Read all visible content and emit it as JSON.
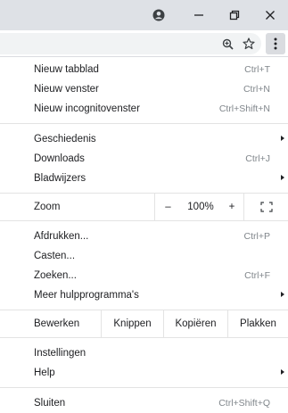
{
  "window": {
    "title_icons": [
      "account-icon",
      "minimize-icon",
      "restore-icon",
      "close-icon"
    ]
  },
  "toolbar": {
    "icons": [
      "zoom-in-icon",
      "bookmark-star-icon",
      "kebab-menu-icon"
    ]
  },
  "menu": {
    "group1": [
      {
        "label": "Nieuw tabblad",
        "shortcut": "Ctrl+T"
      },
      {
        "label": "Nieuw venster",
        "shortcut": "Ctrl+N"
      },
      {
        "label": "Nieuw incognitovenster",
        "shortcut": "Ctrl+Shift+N"
      }
    ],
    "group2": [
      {
        "label": "Geschiedenis",
        "shortcut": ""
      },
      {
        "label": "Downloads",
        "shortcut": "Ctrl+J"
      },
      {
        "label": "Bladwijzers",
        "shortcut": ""
      }
    ],
    "zoom": {
      "label": "Zoom",
      "minus": "–",
      "value": "100%",
      "plus": "+"
    },
    "group3": [
      {
        "label": "Afdrukken...",
        "shortcut": "Ctrl+P"
      },
      {
        "label": "Casten...",
        "shortcut": ""
      },
      {
        "label": "Zoeken...",
        "shortcut": "Ctrl+F"
      },
      {
        "label": "Meer hulpprogramma's",
        "shortcut": ""
      }
    ],
    "edit": {
      "label": "Bewerken",
      "cut": "Knippen",
      "copy": "Kopiëren",
      "paste": "Plakken"
    },
    "group4": [
      {
        "label": "Instellingen",
        "shortcut": ""
      },
      {
        "label": "Help",
        "shortcut": ""
      }
    ],
    "exit": {
      "label": "Sluiten",
      "shortcut": "Ctrl+Shift+Q"
    }
  }
}
